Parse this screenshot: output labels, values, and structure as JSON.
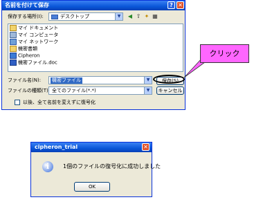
{
  "save_dialog": {
    "title": "名前を付けて保存",
    "save_in_label": "保存する場所(I):",
    "save_in_value": "デスクトップ",
    "places": [
      {
        "label": "マイ ドキュメント",
        "icon": "folder-icon"
      },
      {
        "label": "マイ コンピュータ",
        "icon": "computer-icon"
      },
      {
        "label": "マイ ネットワーク",
        "icon": "network-icon"
      },
      {
        "label": "機密書類",
        "icon": "folder-icon"
      },
      {
        "label": "Cipheron",
        "icon": "app-icon"
      },
      {
        "label": "機密ファイル.doc",
        "icon": "word-doc-icon"
      }
    ],
    "filename_label": "ファイル名(N):",
    "filename_value": "機密ファイル",
    "filetype_label": "ファイルの種類(T):",
    "filetype_value": "全てのファイル(*.*)",
    "save_button": "保存(S)",
    "cancel_button": "キャンセル",
    "checkbox_label": "以後、全て名前を変えずに復号化"
  },
  "callout": {
    "text": "クリック"
  },
  "message_box": {
    "title": "cipheron_trial",
    "message": "1個のファイルの復号化に成功しました",
    "ok_button": "OK"
  },
  "colors": {
    "title_bar": "#0a56d8",
    "dialog_bg": "#ece9d8",
    "callout_bg": "#ff66ff",
    "close_button": "#e0532b"
  }
}
